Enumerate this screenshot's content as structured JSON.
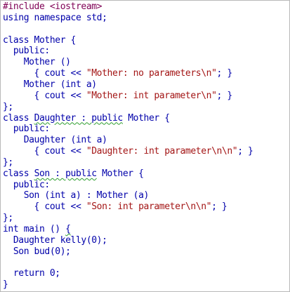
{
  "colors": {
    "preprocessor": "#7f0055",
    "keyword": "#0000aa",
    "string": "#a31515",
    "text": "#000000",
    "squiggle": "#2e9e2e",
    "border": "#b8b8b8",
    "background": "#ffffff"
  },
  "lines": [
    [
      {
        "t": "#include <iostream>",
        "c": "pre"
      }
    ],
    [
      {
        "t": "using namespace std;",
        "c": "kw"
      }
    ],
    [],
    [
      {
        "t": "class Mother {",
        "c": "kw"
      }
    ],
    [
      {
        "t": "  public:",
        "c": "kw"
      }
    ],
    [
      {
        "t": "    Mother ()",
        "c": "kw"
      }
    ],
    [
      {
        "t": "      { cout << ",
        "c": "kw"
      },
      {
        "t": "\"Mother: no parameters\\n\"",
        "c": "str"
      },
      {
        "t": "; }",
        "c": "kw"
      }
    ],
    [
      {
        "t": "    Mother (int a)",
        "c": "kw"
      }
    ],
    [
      {
        "t": "      { cout << ",
        "c": "kw"
      },
      {
        "t": "\"Mother: int parameter\\n\"",
        "c": "str"
      },
      {
        "t": "; }",
        "c": "kw"
      }
    ],
    [
      {
        "t": "};",
        "c": "kw"
      }
    ],
    [
      {
        "t": "class ",
        "c": "kw"
      },
      {
        "t": "Daughter : public",
        "c": "kw",
        "sq": true
      },
      {
        "t": " Mother {",
        "c": "kw"
      }
    ],
    [
      {
        "t": "  public:",
        "c": "kw"
      }
    ],
    [
      {
        "t": "    Daughter (int a)",
        "c": "kw"
      }
    ],
    [
      {
        "t": "      { cout << ",
        "c": "kw"
      },
      {
        "t": "\"Daughter: int parameter\\n\\n\"",
        "c": "str"
      },
      {
        "t": "; }",
        "c": "kw"
      }
    ],
    [
      {
        "t": "};",
        "c": "kw"
      }
    ],
    [
      {
        "t": "class ",
        "c": "kw"
      },
      {
        "t": "Son : public",
        "c": "kw",
        "sq": true
      },
      {
        "t": " Mother {",
        "c": "kw"
      }
    ],
    [
      {
        "t": "  public:",
        "c": "kw"
      }
    ],
    [
      {
        "t": "    Son (int a) : Mother (a)",
        "c": "kw"
      }
    ],
    [
      {
        "t": "      { cout << ",
        "c": "kw"
      },
      {
        "t": "\"Son: int parameter\\n\\n\"",
        "c": "str"
      },
      {
        "t": "; }",
        "c": "kw"
      }
    ],
    [
      {
        "t": "};",
        "c": "kw"
      }
    ],
    [
      {
        "t": "int main () ",
        "c": "kw"
      },
      {
        "t": "{",
        "c": "kw",
        "sq": true
      }
    ],
    [
      {
        "t": "  Daughter kelly(0);",
        "c": "kw"
      }
    ],
    [
      {
        "t": "  Son bud(0);",
        "c": "kw"
      }
    ],
    [],
    [
      {
        "t": "  return 0;",
        "c": "kw"
      }
    ],
    [
      {
        "t": "}",
        "c": "kw"
      }
    ]
  ]
}
